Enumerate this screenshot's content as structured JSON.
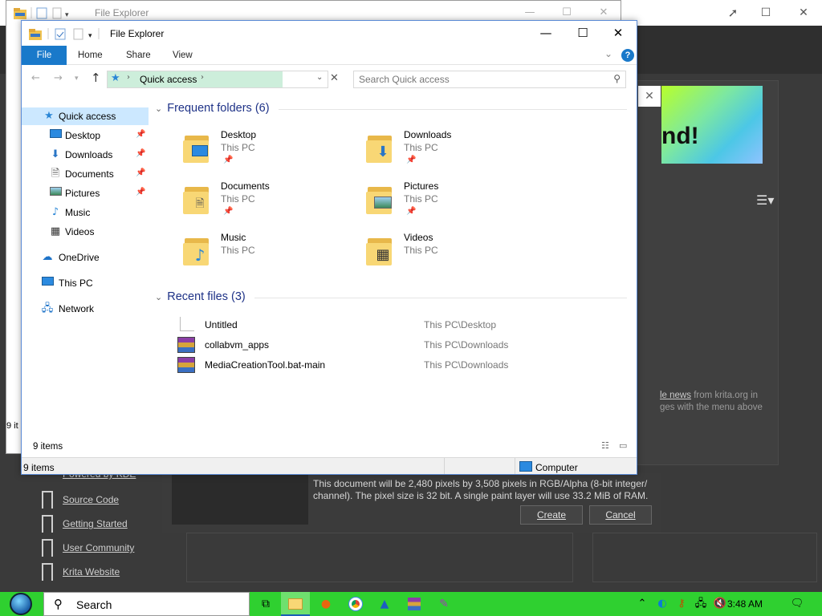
{
  "colors": {
    "accent": "#1979ca",
    "selection": "#cce8ff",
    "address_highlight": "#cdeedb",
    "section_title": "#1e3287",
    "taskbar": "#2fd030"
  },
  "back_window": {
    "title": "File Explorer",
    "status_count_partial": "9 it"
  },
  "window": {
    "title": "File Explorer",
    "controls": {
      "minimize": "—",
      "maximize": "☐",
      "close": "✕"
    }
  },
  "ribbon": {
    "tabs": [
      "File",
      "Home",
      "Share",
      "View"
    ]
  },
  "address": {
    "location": "Quick access",
    "search_placeholder": "Search Quick access"
  },
  "nav_pane": {
    "items": [
      {
        "label": "Quick access",
        "icon": "star-icon",
        "pinned": false
      },
      {
        "label": "Desktop",
        "icon": "desktop-icon",
        "pinned": true
      },
      {
        "label": "Downloads",
        "icon": "download-icon",
        "pinned": true
      },
      {
        "label": "Documents",
        "icon": "documents-icon",
        "pinned": true
      },
      {
        "label": "Pictures",
        "icon": "pictures-icon",
        "pinned": true
      },
      {
        "label": "Music",
        "icon": "music-icon",
        "pinned": false
      },
      {
        "label": "Videos",
        "icon": "videos-icon",
        "pinned": false
      },
      {
        "label": "OneDrive",
        "icon": "cloud-icon",
        "pinned": false
      },
      {
        "label": "This PC",
        "icon": "computer-icon",
        "pinned": false
      },
      {
        "label": "Network",
        "icon": "network-icon",
        "pinned": false
      }
    ]
  },
  "frequent": {
    "heading": "Frequent folders (6)",
    "folders": [
      {
        "name": "Desktop",
        "location": "This PC",
        "pinned": true,
        "overlay": "desktop-icon"
      },
      {
        "name": "Downloads",
        "location": "This PC",
        "pinned": true,
        "overlay": "download-icon"
      },
      {
        "name": "Documents",
        "location": "This PC",
        "pinned": true,
        "overlay": "documents-icon"
      },
      {
        "name": "Pictures",
        "location": "This PC",
        "pinned": true,
        "overlay": "pictures-icon"
      },
      {
        "name": "Music",
        "location": "This PC",
        "pinned": false,
        "overlay": "music-icon"
      },
      {
        "name": "Videos",
        "location": "This PC",
        "pinned": false,
        "overlay": "videos-icon"
      }
    ]
  },
  "recent": {
    "heading": "Recent files (3)",
    "files": [
      {
        "name": "Untitled",
        "path": "This PC\\Desktop",
        "icon": "blank-file-icon"
      },
      {
        "name": "collabvm_apps",
        "path": "This PC\\Downloads",
        "icon": "winrar-icon"
      },
      {
        "name": "MediaCreationTool.bat-main",
        "path": "This PC\\Downloads",
        "icon": "winrar-icon"
      }
    ]
  },
  "status": {
    "inner_count": "9 items",
    "outer_count": "9 items",
    "computer_label": "Computer"
  },
  "krita": {
    "banner_text": "nd!",
    "news_link": "le news",
    "news_rest": " from krita.org in",
    "news_line2": "ges with the menu above",
    "links": [
      "Powered by KDE",
      "Source Code",
      "Getting Started",
      "User Community",
      "Krita Website"
    ],
    "doc_info": "This document will be 2,480 pixels by 3,508 pixels in RGB/Alpha (8-bit integer/ channel). The pixel size is 32 bit. A single paint layer will use 33.2 MiB of RAM.",
    "create_label": "Create",
    "cancel_label": "Cancel"
  },
  "taskbar": {
    "search_label": "Search",
    "time": "3:48 AM"
  }
}
